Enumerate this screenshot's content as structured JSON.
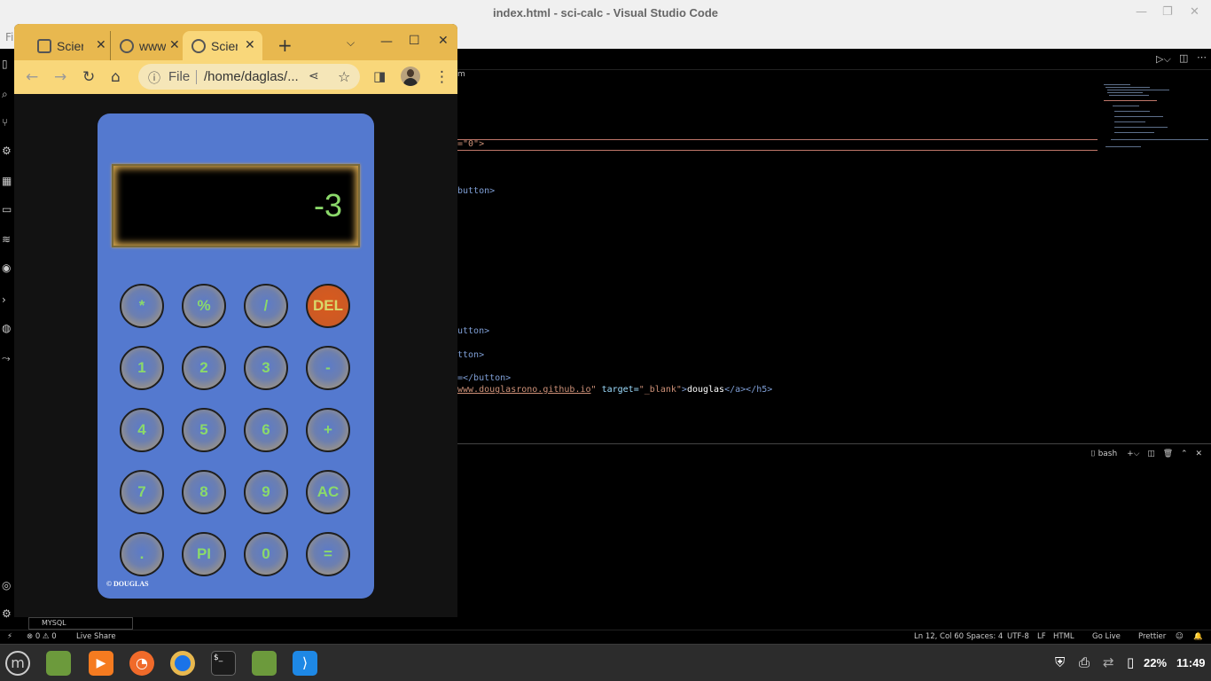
{
  "vscode": {
    "title": "index.html - sci-calc - Visual Studio Code",
    "menu_partial": "Fi",
    "breadcrumb_partial": "m",
    "code": {
      "l1": "=\"0\">",
      "l2": "button>",
      "l3": "utton>",
      "l4": "tton>",
      "l5": "=</button>",
      "l6_url": "www.douglasrono.github.io",
      "l6_target_attr": "target=",
      "l6_target_val": "\"_blank\"",
      "l6_text": "douglas",
      "l6_close": "</a></h5>"
    },
    "panel": {
      "terminal": "bash"
    },
    "mysql": "MYSQL",
    "status": {
      "errors": "⊗ 0 ⚠ 0",
      "liveshare": "Live Share",
      "position": "Ln 12, Col 60",
      "spaces": "Spaces: 4",
      "encoding": "UTF-8",
      "eol": "LF",
      "language": "HTML",
      "golive": "Go Live",
      "prettier": "Prettier"
    }
  },
  "chrome": {
    "tabs": [
      {
        "label": "Scier",
        "active": false
      },
      {
        "label": "www",
        "active": false
      },
      {
        "label": "Scier",
        "active": true
      }
    ],
    "new_tab": "+",
    "omnibox": {
      "scheme": "File",
      "url": "/home/daglas/..."
    }
  },
  "calculator": {
    "display": "-3",
    "keys": [
      [
        "*",
        "%",
        "/",
        "DEL"
      ],
      [
        "1",
        "2",
        "3",
        "-"
      ],
      [
        "4",
        "5",
        "6",
        "+"
      ],
      [
        "7",
        "8",
        "9",
        "AC"
      ],
      [
        ".",
        "PI",
        "0",
        "="
      ]
    ],
    "copyright": "© DOUGLAS"
  },
  "taskbar": {
    "battery": "22%",
    "clock": "11:49"
  },
  "colors": {
    "calc_body": "#5479cf",
    "key_text": "#8bd96a",
    "del_key": "#d85a1e",
    "chrome_tabstrip": "#e8b84f",
    "chrome_toolbar": "#f9d77a"
  }
}
